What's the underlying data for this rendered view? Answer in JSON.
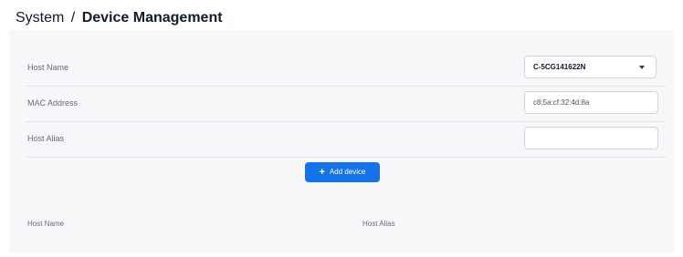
{
  "breadcrumb": {
    "section": "System",
    "separator": "/",
    "current": "Device Management"
  },
  "form": {
    "host_name": {
      "label": "Host Name",
      "selected_value": "C-5CG141622N"
    },
    "mac_address": {
      "label": "MAC Address",
      "value": "c8:5a:cf:32:4d:8a"
    },
    "host_alias": {
      "label": "Host Alias",
      "value": ""
    },
    "add_button": {
      "icon": "plus-icon",
      "label": "Add device"
    }
  },
  "table": {
    "columns": [
      "Host Name",
      "Host Alias"
    ],
    "rows": []
  },
  "colors": {
    "accent": "#1473e6",
    "panel_background": "#f7f7f9",
    "title_text": "#141a2e"
  }
}
